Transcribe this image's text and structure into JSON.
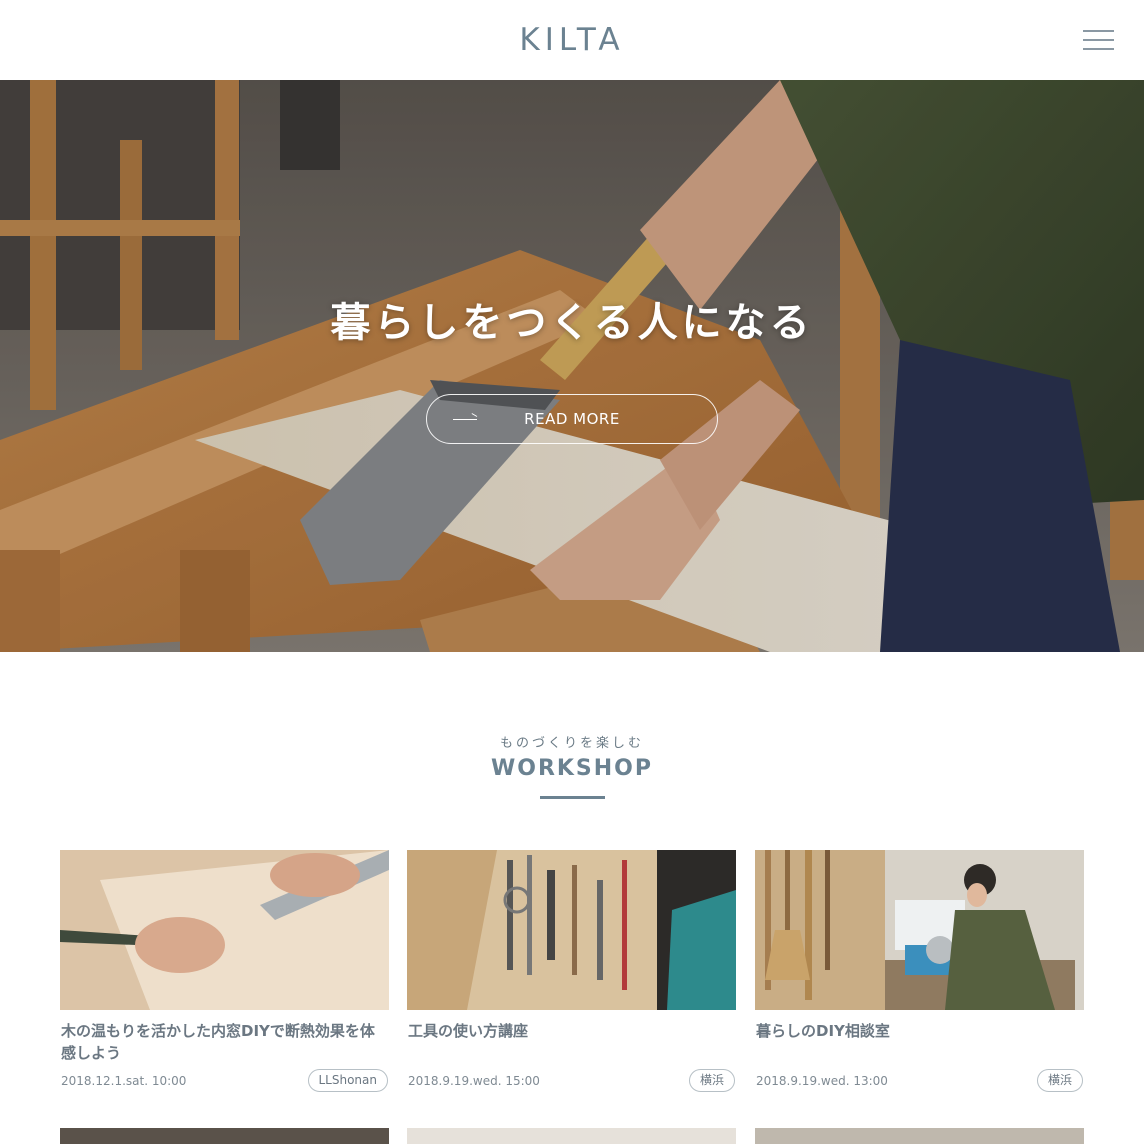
{
  "header": {
    "logo": "KILTA"
  },
  "hero": {
    "title": "暮らしをつくる人になる",
    "cta_label": "READ MORE"
  },
  "workshop": {
    "subtitle": "ものづくりを楽しむ",
    "title": "WORKSHOP",
    "cards": [
      {
        "title": "木の温もりを活かした内窓DIYで断熱効果を体感しよう",
        "date": "2018.12.1.sat. 10:00",
        "tag": "LLShonan"
      },
      {
        "title": "工具の使い方講座",
        "date": "2018.9.19.wed. 15:00",
        "tag": "横浜"
      },
      {
        "title": "暮らしのDIY相談室",
        "date": "2018.9.19.wed. 13:00",
        "tag": "横浜"
      }
    ]
  },
  "colors": {
    "accent": "#6b8291",
    "text": "#6b7782",
    "white": "#ffffff"
  },
  "icons": {
    "menu": "hamburger-icon",
    "cta_arrow": "arrow-right-icon"
  }
}
